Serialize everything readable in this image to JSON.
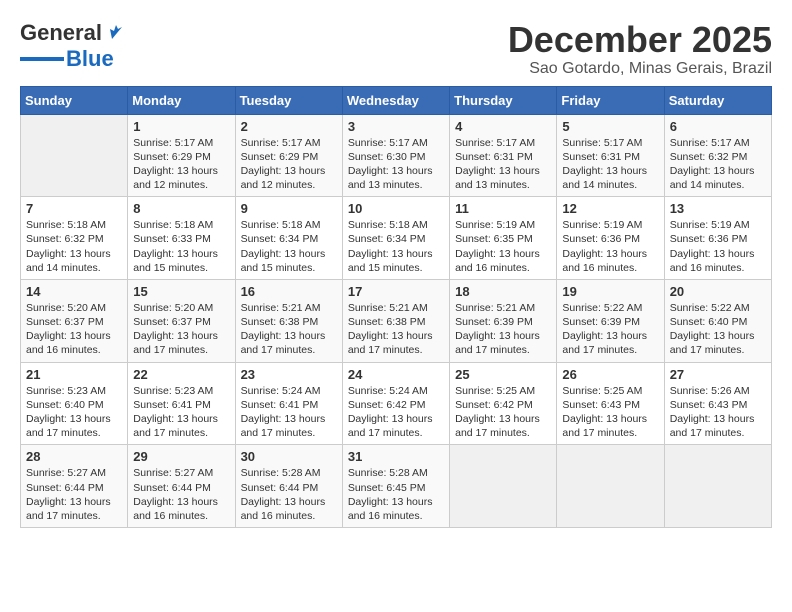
{
  "logo": {
    "text_general": "General",
    "text_blue": "Blue"
  },
  "header": {
    "month": "December 2025",
    "location": "Sao Gotardo, Minas Gerais, Brazil"
  },
  "weekdays": [
    "Sunday",
    "Monday",
    "Tuesday",
    "Wednesday",
    "Thursday",
    "Friday",
    "Saturday"
  ],
  "weeks": [
    [
      {
        "day": "",
        "info": ""
      },
      {
        "day": "1",
        "info": "Sunrise: 5:17 AM\nSunset: 6:29 PM\nDaylight: 13 hours\nand 12 minutes."
      },
      {
        "day": "2",
        "info": "Sunrise: 5:17 AM\nSunset: 6:29 PM\nDaylight: 13 hours\nand 12 minutes."
      },
      {
        "day": "3",
        "info": "Sunrise: 5:17 AM\nSunset: 6:30 PM\nDaylight: 13 hours\nand 13 minutes."
      },
      {
        "day": "4",
        "info": "Sunrise: 5:17 AM\nSunset: 6:31 PM\nDaylight: 13 hours\nand 13 minutes."
      },
      {
        "day": "5",
        "info": "Sunrise: 5:17 AM\nSunset: 6:31 PM\nDaylight: 13 hours\nand 14 minutes."
      },
      {
        "day": "6",
        "info": "Sunrise: 5:17 AM\nSunset: 6:32 PM\nDaylight: 13 hours\nand 14 minutes."
      }
    ],
    [
      {
        "day": "7",
        "info": "Sunrise: 5:18 AM\nSunset: 6:32 PM\nDaylight: 13 hours\nand 14 minutes."
      },
      {
        "day": "8",
        "info": "Sunrise: 5:18 AM\nSunset: 6:33 PM\nDaylight: 13 hours\nand 15 minutes."
      },
      {
        "day": "9",
        "info": "Sunrise: 5:18 AM\nSunset: 6:34 PM\nDaylight: 13 hours\nand 15 minutes."
      },
      {
        "day": "10",
        "info": "Sunrise: 5:18 AM\nSunset: 6:34 PM\nDaylight: 13 hours\nand 15 minutes."
      },
      {
        "day": "11",
        "info": "Sunrise: 5:19 AM\nSunset: 6:35 PM\nDaylight: 13 hours\nand 16 minutes."
      },
      {
        "day": "12",
        "info": "Sunrise: 5:19 AM\nSunset: 6:36 PM\nDaylight: 13 hours\nand 16 minutes."
      },
      {
        "day": "13",
        "info": "Sunrise: 5:19 AM\nSunset: 6:36 PM\nDaylight: 13 hours\nand 16 minutes."
      }
    ],
    [
      {
        "day": "14",
        "info": "Sunrise: 5:20 AM\nSunset: 6:37 PM\nDaylight: 13 hours\nand 16 minutes."
      },
      {
        "day": "15",
        "info": "Sunrise: 5:20 AM\nSunset: 6:37 PM\nDaylight: 13 hours\nand 17 minutes."
      },
      {
        "day": "16",
        "info": "Sunrise: 5:21 AM\nSunset: 6:38 PM\nDaylight: 13 hours\nand 17 minutes."
      },
      {
        "day": "17",
        "info": "Sunrise: 5:21 AM\nSunset: 6:38 PM\nDaylight: 13 hours\nand 17 minutes."
      },
      {
        "day": "18",
        "info": "Sunrise: 5:21 AM\nSunset: 6:39 PM\nDaylight: 13 hours\nand 17 minutes."
      },
      {
        "day": "19",
        "info": "Sunrise: 5:22 AM\nSunset: 6:39 PM\nDaylight: 13 hours\nand 17 minutes."
      },
      {
        "day": "20",
        "info": "Sunrise: 5:22 AM\nSunset: 6:40 PM\nDaylight: 13 hours\nand 17 minutes."
      }
    ],
    [
      {
        "day": "21",
        "info": "Sunrise: 5:23 AM\nSunset: 6:40 PM\nDaylight: 13 hours\nand 17 minutes."
      },
      {
        "day": "22",
        "info": "Sunrise: 5:23 AM\nSunset: 6:41 PM\nDaylight: 13 hours\nand 17 minutes."
      },
      {
        "day": "23",
        "info": "Sunrise: 5:24 AM\nSunset: 6:41 PM\nDaylight: 13 hours\nand 17 minutes."
      },
      {
        "day": "24",
        "info": "Sunrise: 5:24 AM\nSunset: 6:42 PM\nDaylight: 13 hours\nand 17 minutes."
      },
      {
        "day": "25",
        "info": "Sunrise: 5:25 AM\nSunset: 6:42 PM\nDaylight: 13 hours\nand 17 minutes."
      },
      {
        "day": "26",
        "info": "Sunrise: 5:25 AM\nSunset: 6:43 PM\nDaylight: 13 hours\nand 17 minutes."
      },
      {
        "day": "27",
        "info": "Sunrise: 5:26 AM\nSunset: 6:43 PM\nDaylight: 13 hours\nand 17 minutes."
      }
    ],
    [
      {
        "day": "28",
        "info": "Sunrise: 5:27 AM\nSunset: 6:44 PM\nDaylight: 13 hours\nand 17 minutes."
      },
      {
        "day": "29",
        "info": "Sunrise: 5:27 AM\nSunset: 6:44 PM\nDaylight: 13 hours\nand 16 minutes."
      },
      {
        "day": "30",
        "info": "Sunrise: 5:28 AM\nSunset: 6:44 PM\nDaylight: 13 hours\nand 16 minutes."
      },
      {
        "day": "31",
        "info": "Sunrise: 5:28 AM\nSunset: 6:45 PM\nDaylight: 13 hours\nand 16 minutes."
      },
      {
        "day": "",
        "info": ""
      },
      {
        "day": "",
        "info": ""
      },
      {
        "day": "",
        "info": ""
      }
    ]
  ]
}
